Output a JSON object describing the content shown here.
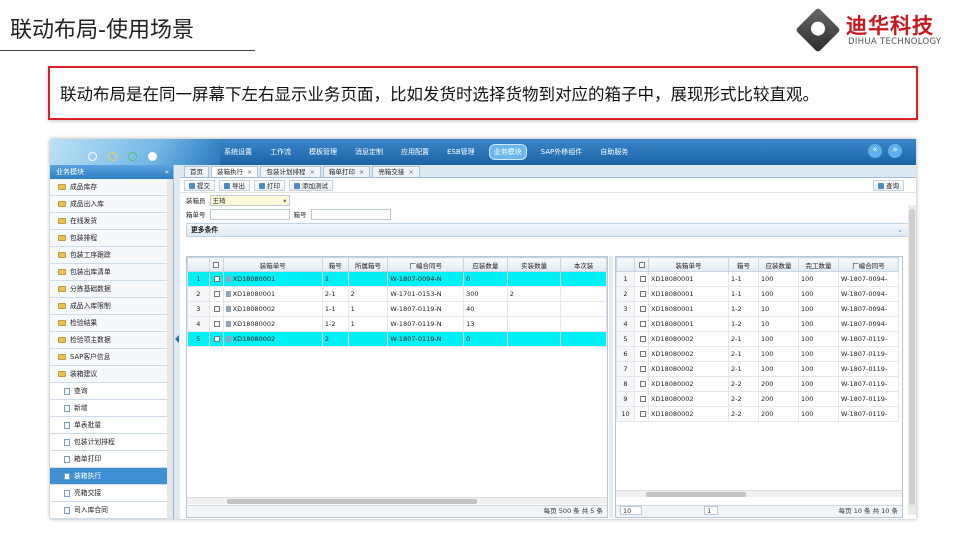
{
  "slide": {
    "title": "联动布局-使用场景",
    "logo_cn": "迪华科技",
    "logo_en": "DIHUA TECHNOLOGY",
    "callout": "联动布局是在同一屏幕下左右显示业务页面，比如发货时选择货物到对应的箱子中，展现形式比较直观。"
  },
  "app": {
    "menu": [
      "系统设置",
      "工作流",
      "模板管理",
      "消息定制",
      "应用配置",
      "ESB管理",
      "业务模块",
      "SAP外移组件",
      "自助服务"
    ],
    "menu_active": 6,
    "sidebar": {
      "title": "业务模块",
      "collapse_glyph": "«",
      "items": [
        {
          "label": "成品库存",
          "type": "folder"
        },
        {
          "label": "成品出入库",
          "type": "folder"
        },
        {
          "label": "在线发货",
          "type": "folder"
        },
        {
          "label": "包装排程",
          "type": "folder"
        },
        {
          "label": "包装工序跟踪",
          "type": "folder"
        },
        {
          "label": "包装出库清单",
          "type": "folder"
        },
        {
          "label": "分拣基础数据",
          "type": "folder"
        },
        {
          "label": "成品入库限制",
          "type": "folder"
        },
        {
          "label": "检验结果",
          "type": "folder"
        },
        {
          "label": "检验项主数据",
          "type": "folder"
        },
        {
          "label": "SAP客户信息",
          "type": "folder"
        },
        {
          "label": "装箱建议",
          "type": "folder"
        },
        {
          "label": "查询",
          "type": "page"
        },
        {
          "label": "新增",
          "type": "page"
        },
        {
          "label": "单表批量",
          "type": "page"
        },
        {
          "label": "包装计划排程",
          "type": "page"
        },
        {
          "label": "箱单打印",
          "type": "page"
        },
        {
          "label": "装箱执行",
          "type": "page",
          "selected": true
        },
        {
          "label": "亮箱交接",
          "type": "page"
        },
        {
          "label": "司入库合同",
          "type": "page"
        }
      ]
    },
    "tabs": [
      {
        "label": "首页",
        "closable": false
      },
      {
        "label": "装箱执行",
        "closable": true,
        "active": true
      },
      {
        "label": "包装计划排程",
        "closable": true
      },
      {
        "label": "箱单打印",
        "closable": true
      },
      {
        "label": "亮箱交接",
        "closable": true
      }
    ],
    "toolbar": {
      "submit": "提交",
      "export": "导出",
      "print": "打印",
      "add_test": "添加测试",
      "query": "查询"
    },
    "form": {
      "packer_label": "装箱员",
      "packer_value": "王琦",
      "box_no_label": "箱单号",
      "box_label": "箱号"
    },
    "more_conditions": "更多条件",
    "left_grid": {
      "columns": [
        "",
        "",
        "装箱单号",
        "箱号",
        "所属箱号",
        "厂编合同号",
        "应装数量",
        "实装数量",
        "本次装"
      ],
      "rows": [
        {
          "n": "1",
          "id": "XD18080001",
          "box": "1",
          "parent": "",
          "contract": "W-1807-0094-N",
          "qty": "0",
          "actual": "",
          "hl": true
        },
        {
          "n": "2",
          "id": "XD18080001",
          "box": "2-1",
          "parent": "2",
          "contract": "W-1701-0153-N",
          "qty": "300",
          "actual": "2",
          "hl": false
        },
        {
          "n": "3",
          "id": "XD18080002",
          "box": "1-1",
          "parent": "1",
          "contract": "W-1807-0119-N",
          "qty": "40",
          "actual": "",
          "hl": false
        },
        {
          "n": "4",
          "id": "XD18080002",
          "box": "1-2",
          "parent": "1",
          "contract": "W-1807-0119-N",
          "qty": "13",
          "actual": "",
          "hl": false
        },
        {
          "n": "5",
          "id": "XD18080002",
          "box": "2",
          "parent": "",
          "contract": "W-1807-0119-N",
          "qty": "0",
          "actual": "",
          "hl": true
        }
      ],
      "pager": "每页 500 条 共 5 条"
    },
    "right_grid": {
      "columns": [
        "",
        "",
        "装箱单号",
        "箱号",
        "应装数量",
        "完工数量",
        "厂编合同号"
      ],
      "rows": [
        {
          "n": "1",
          "id": "XD18080001",
          "box": "1-1",
          "qty": "100",
          "done": "100",
          "contract": "W-1807-0094-"
        },
        {
          "n": "2",
          "id": "XD18080001",
          "box": "1-1",
          "qty": "100",
          "done": "100",
          "contract": "W-1807-0094-"
        },
        {
          "n": "3",
          "id": "XD18080001",
          "box": "1-2",
          "qty": "10",
          "done": "100",
          "contract": "W-1807-0094-"
        },
        {
          "n": "4",
          "id": "XD18080001",
          "box": "1-2",
          "qty": "10",
          "done": "100",
          "contract": "W-1807-0094-"
        },
        {
          "n": "5",
          "id": "XD18080002",
          "box": "2-1",
          "qty": "100",
          "done": "100",
          "contract": "W-1807-0119-"
        },
        {
          "n": "6",
          "id": "XD18080002",
          "box": "2-1",
          "qty": "100",
          "done": "100",
          "contract": "W-1807-0119-"
        },
        {
          "n": "7",
          "id": "XD18080002",
          "box": "2-1",
          "qty": "100",
          "done": "100",
          "contract": "W-1807-0119-"
        },
        {
          "n": "8",
          "id": "XD18080002",
          "box": "2-2",
          "qty": "200",
          "done": "100",
          "contract": "W-1807-0119-"
        },
        {
          "n": "9",
          "id": "XD18080002",
          "box": "2-2",
          "qty": "200",
          "done": "100",
          "contract": "W-1807-0119-"
        },
        {
          "n": "10",
          "id": "XD18080002",
          "box": "2-2",
          "qty": "200",
          "done": "100",
          "contract": "W-1807-0119-"
        }
      ],
      "page_size": "10",
      "page": "1",
      "pager": "每页 10 条 共 10 条"
    }
  },
  "colors": {
    "highlight": "#00f0f5",
    "callout_border": "#d8232a",
    "brand_red": "#c8161d",
    "banner": "#1c63a8"
  }
}
